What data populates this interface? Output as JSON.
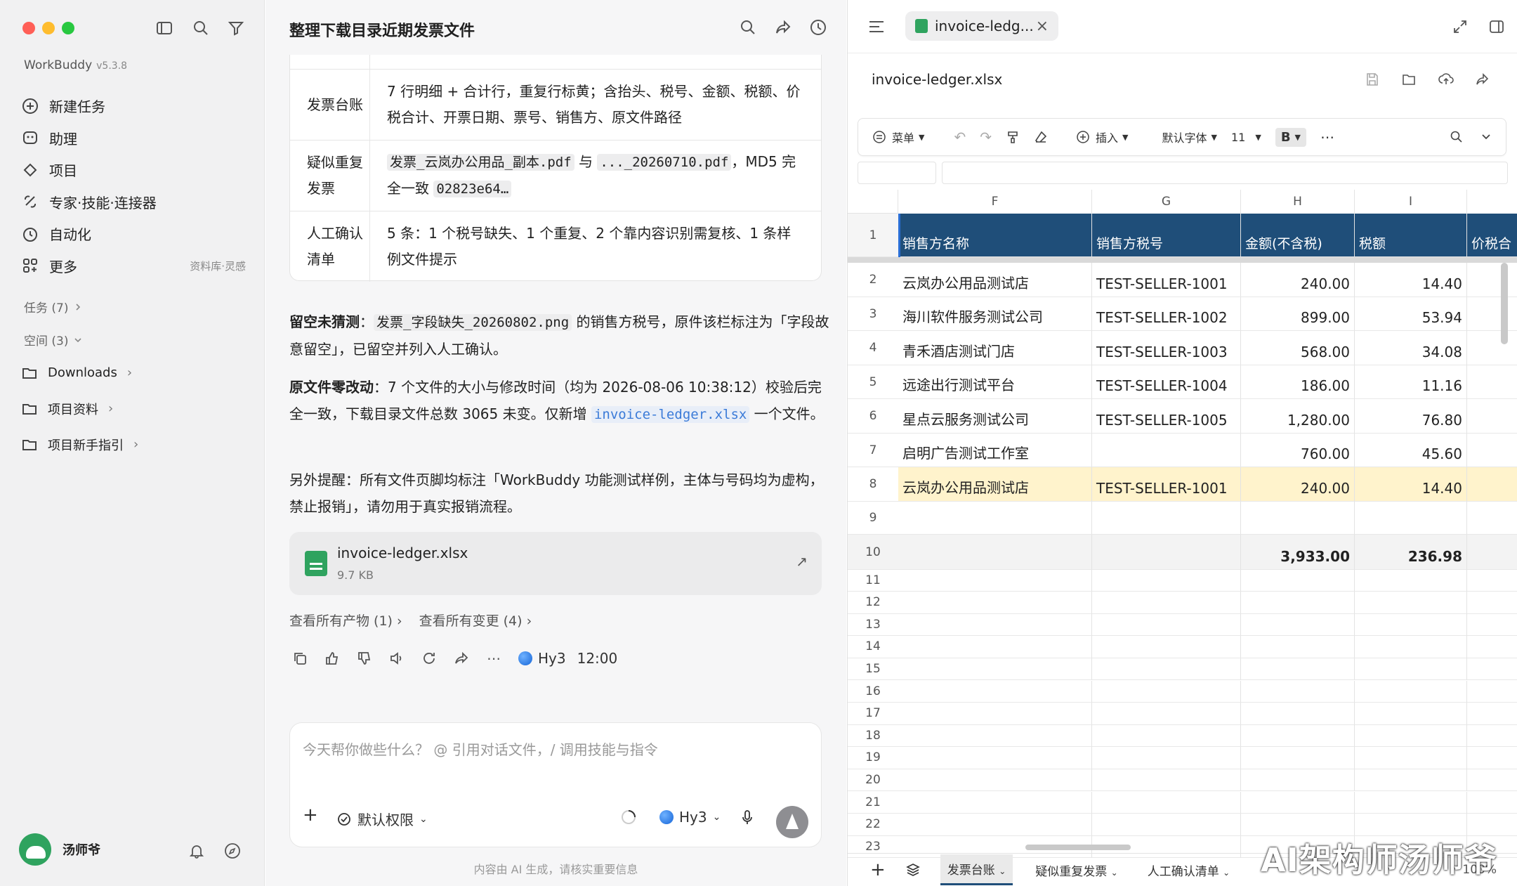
{
  "sidebar": {
    "brand": "WorkBuddy",
    "version": "v5.3.8",
    "nav": [
      {
        "label": "新建任务",
        "icon": "plus-circle-icon"
      },
      {
        "label": "助理",
        "icon": "assistant-icon"
      },
      {
        "label": "项目",
        "icon": "project-icon"
      },
      {
        "label": "专家·技能·连接器",
        "icon": "connector-icon"
      },
      {
        "label": "自动化",
        "icon": "clock-icon"
      },
      {
        "label": "更多",
        "icon": "grid-icon",
        "extra": "资料库·灵感"
      }
    ],
    "tasks_label": "任务 (7)",
    "spaces_label": "空间 (3)",
    "folders": [
      "Downloads",
      "项目资料",
      "项目新手指引"
    ],
    "user": "汤师爷"
  },
  "chat": {
    "title": "整理下载目录近期发票文件",
    "table": [
      {
        "k": "发票台账",
        "v": "7 行明细 + 合计行，重复行标黄；含抬头、税号、金额、税额、价税合计、开票日期、票号、销售方、原文件路径"
      },
      {
        "k": "疑似重复发票",
        "v_code1": "发票_云岚办公用品_副本.pdf",
        "v_mid": " 与 ",
        "v_code2": "..._20260710.pdf",
        "v_tail": "，MD5 完全一致 ",
        "v_code3": "02823e64…"
      },
      {
        "k": "人工确认清单",
        "v": "5 条：1 个税号缺失、1 个重复、2 个靠内容识别需复核、1 条样例文件提示"
      }
    ],
    "p1_bold": "留空未猜测",
    "p1_code": "发票_字段缺失_20260802.png",
    "p1_text": " 的销售方税号，原件该栏标注为「字段故意留空」，已留空并列入人工确认。",
    "p2_bold": "原文件零改动",
    "p2_text": "：7 个文件的大小与修改时间（均为 2026-08-06 10:38:12）校验后完全一致，下载目录文件总数 3065 未变。仅新增 ",
    "p2_link": "invoice-ledger.xlsx",
    "p2_tail": " 一个文件。",
    "p3": "另外提醒：所有文件页脚均标注「WorkBuddy 功能测试样例，主体与号码均为虚构，禁止报销」，请勿用于真实报销流程。",
    "file_name": "invoice-ledger.xlsx",
    "file_size": "9.7 KB",
    "link_artifacts": "查看所有产物 (1) ›",
    "link_changes": "查看所有变更 (4) ›",
    "model": "Hy3",
    "time": "12:00",
    "input_placeholder": "今天帮你做些什么？ @ 引用对话文件，/ 调用技能与指令",
    "permission": "默认权限",
    "model_select": "Hy3",
    "footer": "内容由 AI 生成，请核实重要信息"
  },
  "sheet": {
    "tab_title": "invoice-ledg...",
    "file_title": "invoice-ledger.xlsx",
    "toolbar": {
      "menu": "菜单",
      "insert": "插入",
      "font": "默认字体",
      "size": "11",
      "bold": "B"
    },
    "columns": [
      "F",
      "G",
      "H",
      "I"
    ],
    "headers": [
      "销售方名称",
      "销售方税号",
      "金额(不含税)",
      "税额",
      "价税合"
    ],
    "rows": [
      [
        "云岚办公用品测试店",
        "TEST-SELLER-1001",
        "240.00",
        "14.40"
      ],
      [
        "海川软件服务测试公司",
        "TEST-SELLER-1002",
        "899.00",
        "53.94"
      ],
      [
        "青禾酒店测试门店",
        "TEST-SELLER-1003",
        "568.00",
        "34.08"
      ],
      [
        "远途出行测试平台",
        "TEST-SELLER-1004",
        "186.00",
        "11.16"
      ],
      [
        "星点云服务测试公司",
        "TEST-SELLER-1005",
        "1,280.00",
        "76.80"
      ],
      [
        "启明广告测试工作室",
        "",
        "760.00",
        "45.60"
      ],
      [
        "云岚办公用品测试店",
        "TEST-SELLER-1001",
        "240.00",
        "14.40"
      ]
    ],
    "total": [
      "",
      "",
      "3,933.00",
      "236.98"
    ],
    "highlight_color": "#fff3cc",
    "header_color": "#1f4e79",
    "sheet_tabs": [
      "发票台账",
      "疑似重复发票",
      "人工确认清单"
    ],
    "zoom": "100%"
  },
  "watermark": "AI架构师汤师爷"
}
